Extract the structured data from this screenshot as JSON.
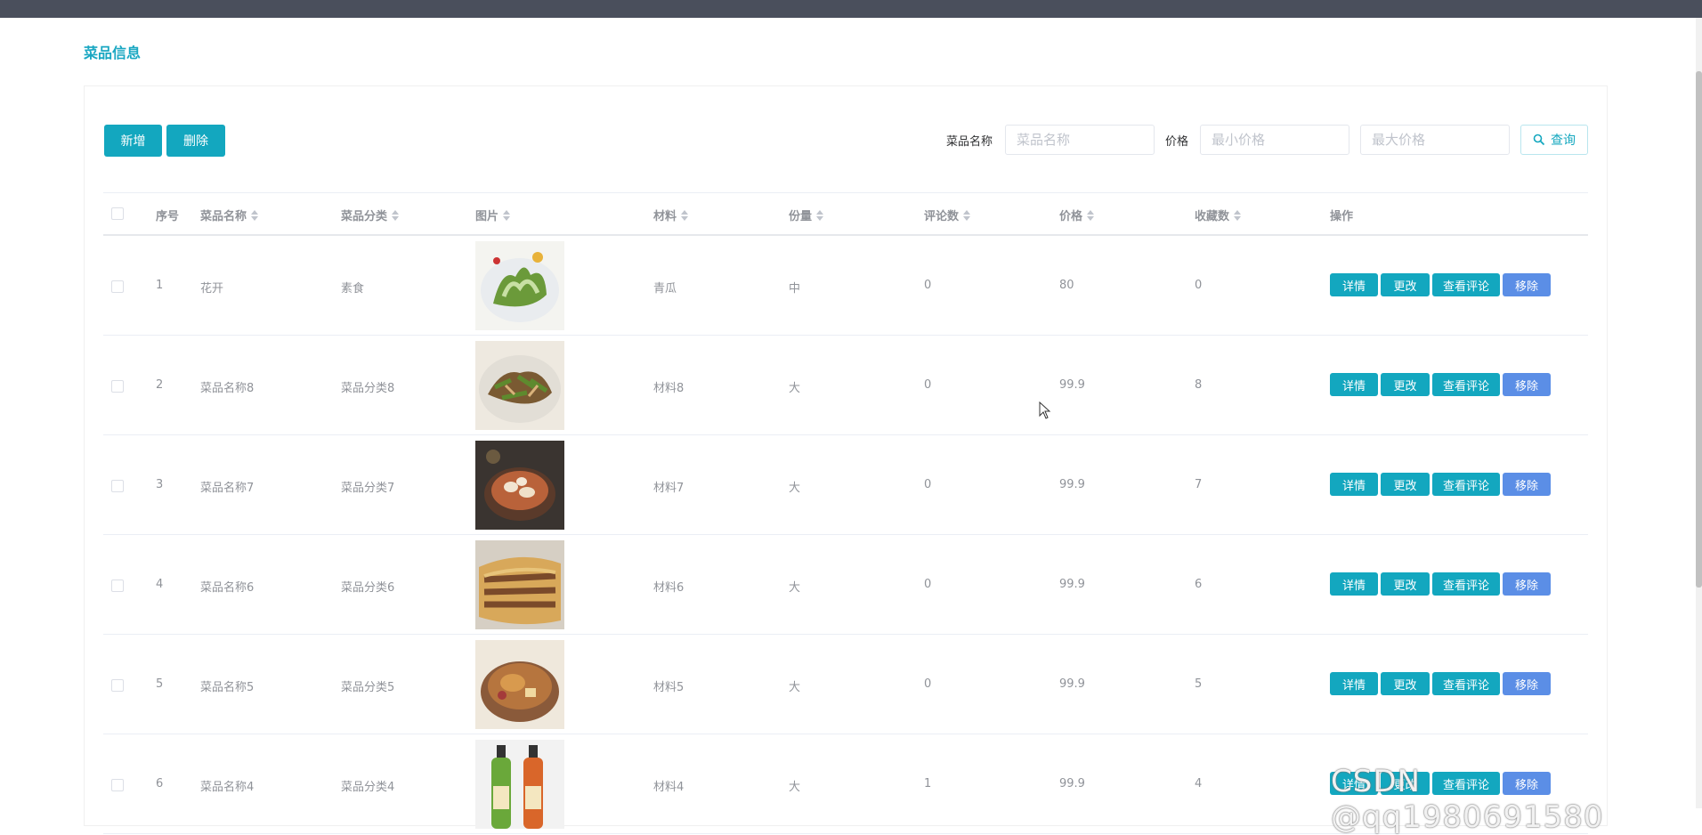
{
  "page": {
    "title": "菜品信息"
  },
  "toolbar": {
    "add_label": "新增",
    "delete_label": "删除",
    "name_label": "菜品名称",
    "name_placeholder": "菜品名称",
    "price_label": "价格",
    "min_price_placeholder": "最小价格",
    "max_price_placeholder": "最大价格",
    "query_label": "查询"
  },
  "table": {
    "headers": {
      "index": "序号",
      "name": "菜品名称",
      "category": "菜品分类",
      "image": "图片",
      "material": "材料",
      "portion": "份量",
      "comments": "评论数",
      "price": "价格",
      "favorites": "收藏数",
      "actions": "操作"
    },
    "actions": {
      "detail": "详情",
      "edit": "更改",
      "view_comments": "查看评论",
      "remove": "移除"
    },
    "rows": [
      {
        "index": "1",
        "name": "花开",
        "category": "素食",
        "material": "青瓜",
        "portion": "中",
        "comments": "0",
        "price": "80",
        "favorites": "0",
        "image": "greens-roll"
      },
      {
        "index": "2",
        "name": "菜品名称8",
        "category": "菜品分类8",
        "material": "材料8",
        "portion": "大",
        "comments": "0",
        "price": "99.9",
        "favorites": "8",
        "image": "stir-fry"
      },
      {
        "index": "3",
        "name": "菜品名称7",
        "category": "菜品分类7",
        "material": "材料7",
        "portion": "大",
        "comments": "0",
        "price": "99.9",
        "favorites": "7",
        "image": "soup-bowl"
      },
      {
        "index": "4",
        "name": "菜品名称6",
        "category": "菜品分类6",
        "material": "材料6",
        "portion": "大",
        "comments": "0",
        "price": "99.9",
        "favorites": "6",
        "image": "pancake"
      },
      {
        "index": "5",
        "name": "菜品名称5",
        "category": "菜品分类5",
        "material": "材料5",
        "portion": "大",
        "comments": "0",
        "price": "99.9",
        "favorites": "5",
        "image": "claypot-chicken"
      },
      {
        "index": "6",
        "name": "菜品名称4",
        "category": "菜品分类4",
        "material": "材料4",
        "portion": "大",
        "comments": "1",
        "price": "99.9",
        "favorites": "4",
        "image": "drink-bottles"
      }
    ]
  },
  "watermark": "CSDN @qq1980691580",
  "colors": {
    "accent": "#13a7bf",
    "remove": "#5b8ee6",
    "topbar": "#4a4f5c"
  }
}
